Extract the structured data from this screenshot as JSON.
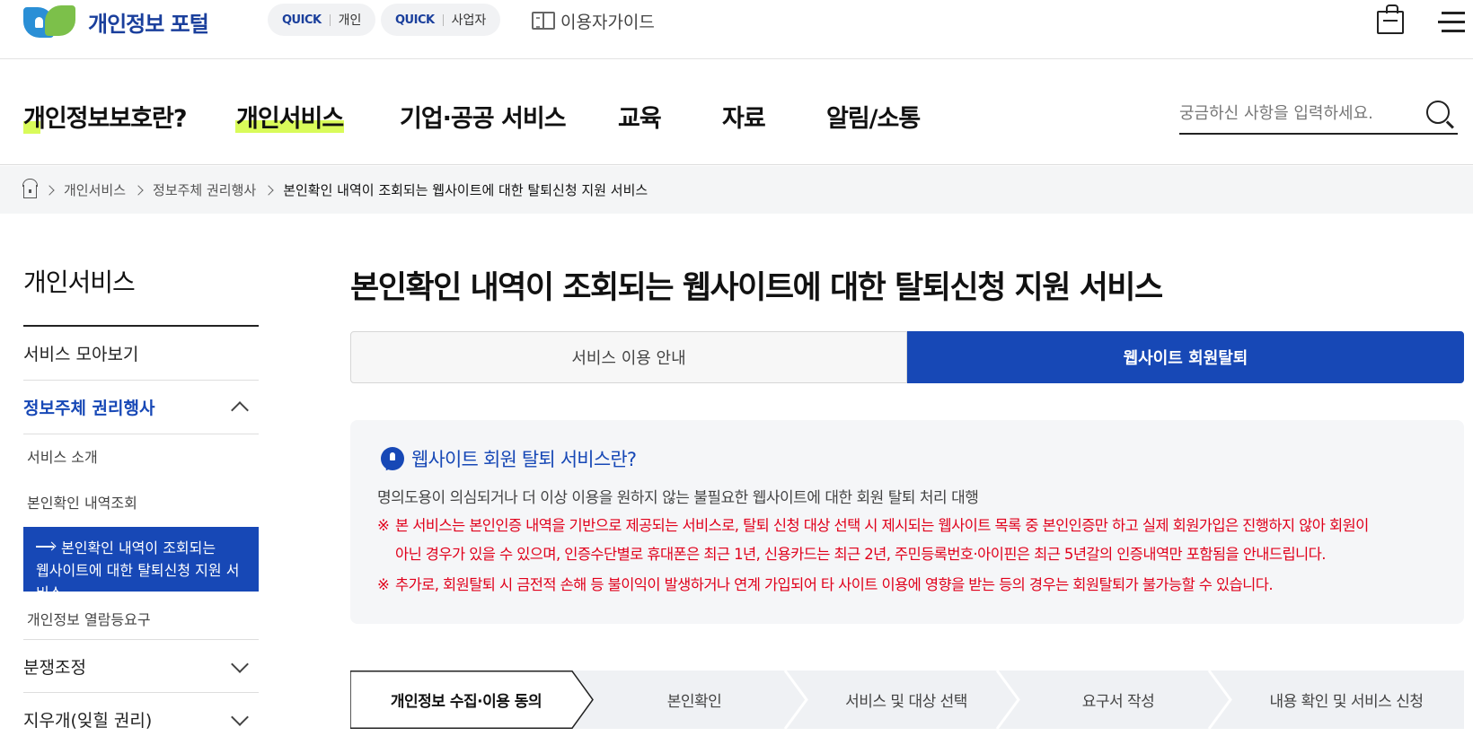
{
  "header": {
    "logo_text": "개인정보 포털",
    "quick": [
      {
        "tag": "QUICK",
        "label": "개인"
      },
      {
        "tag": "QUICK",
        "label": "사업자"
      }
    ],
    "guide_label": "이용자가이드"
  },
  "nav": {
    "items": [
      {
        "label": "개인정보보호란?",
        "highlight": "partial"
      },
      {
        "label": "개인서비스",
        "highlight": "full"
      },
      {
        "label": "기업·공공 서비스"
      },
      {
        "label": "교육"
      },
      {
        "label": "자료"
      },
      {
        "label": "알림/소통"
      }
    ],
    "search_placeholder": "궁금하신 사항을 입력하세요."
  },
  "breadcrumb": [
    "개인서비스",
    "정보주체 권리행사",
    "본인확인 내역이 조회되는 웹사이트에 대한 탈퇴신청 지원 서비스"
  ],
  "sidebar": {
    "title": "개인서비스",
    "items": [
      {
        "label": "서비스 모아보기"
      },
      {
        "label": "정보주체 권리행사",
        "active": true,
        "expanded": true
      },
      {
        "label": "분쟁조정"
      },
      {
        "label": "지우개(잊힐 권리)"
      }
    ],
    "sub_items": [
      "서비스 소개",
      "본인확인 내역조회",
      "본인확인 내역이 조회되는",
      "웹사이트에 대한 탈퇴신청 지원 서비스",
      "개인정보 열람등요구"
    ]
  },
  "content": {
    "title": "본인확인 내역이 조회되는 웹사이트에 대한 탈퇴신청 지원 서비스",
    "tabs": [
      {
        "label": "서비스 이용 안내",
        "active": false
      },
      {
        "label": "웹사이트 회원탈퇴",
        "active": true
      }
    ],
    "info": {
      "heading": "웹사이트 회원 탈퇴 서비스란?",
      "description": "명의도용이 의심되거나 더 이상 이용을 원하지 않는 불필요한 웹사이트에 대한 회원 탈퇴 처리 대행",
      "note_mark": "※",
      "note1_line1": "본 서비스는 본인인증 내역을 기반으로 제공되는 서비스로, 탈퇴 신청 대상 선택 시 제시되는 웹사이트 목록 중 본인인증만 하고 실제 회원가입은 진행하지 않아 회원이",
      "note1_line2": "아닌 경우가 있을 수 있으며, 인증수단별로 휴대폰은 최근 1년, 신용카드는 최근 2년, 주민등록번호·아이핀은 최근 5년갈의 인증내역만 포함됨을 안내드립니다.",
      "note2": "추가로, 회원탈퇴 시 금전적 손해 등 불이익이 발생하거나 연계 가입되어 타 사이트 이용에 영향을 받는 등의 경우는 회원탈퇴가 불가능할 수 있습니다."
    },
    "steps": [
      "개인정보 수집·이용 동의",
      "본인확인",
      "서비스 및 대상 선택",
      "요구서 작성",
      "내용 확인 및 서비스 신청"
    ],
    "current_step": 1
  },
  "colors": {
    "brand_blue": "#1748b6",
    "highlight": "#d9fb5a",
    "warning_red": "#e0001b"
  }
}
